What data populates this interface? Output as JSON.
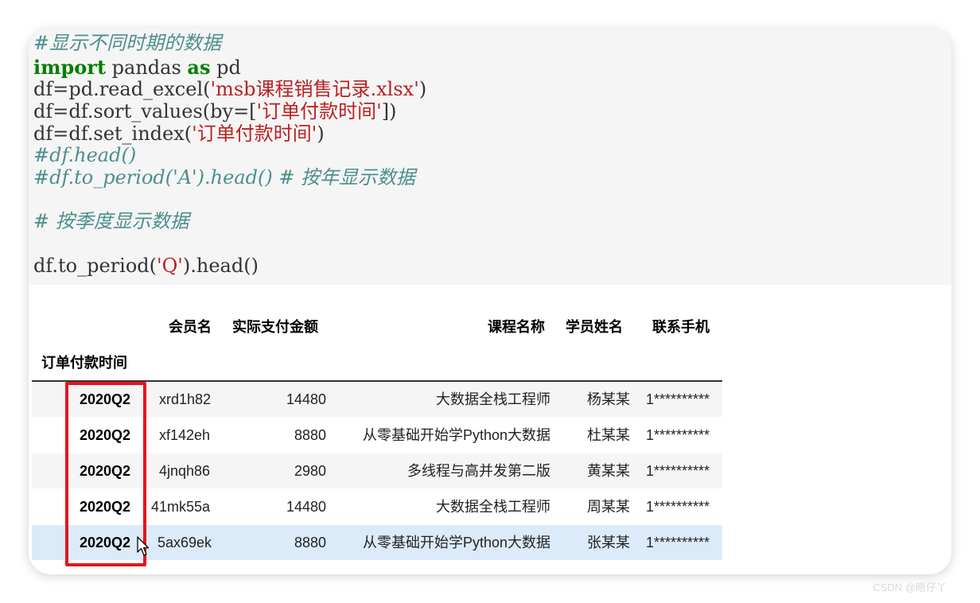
{
  "code_cell": {
    "lines": [
      {
        "segments": [
          {
            "cls": "cm",
            "text": "#显示不同时期的数据"
          }
        ]
      },
      {
        "segments": [
          {
            "cls": "kw",
            "text": "import"
          },
          {
            "cls": "",
            "text": " pandas "
          },
          {
            "cls": "kw",
            "text": "as"
          },
          {
            "cls": "",
            "text": " pd"
          }
        ]
      },
      {
        "segments": [
          {
            "cls": "",
            "text": "df=pd.read_excel("
          },
          {
            "cls": "st",
            "text": "'msb课程销售记录.xlsx'"
          },
          {
            "cls": "",
            "text": ")"
          }
        ]
      },
      {
        "segments": [
          {
            "cls": "",
            "text": "df=df.sort_values(by=["
          },
          {
            "cls": "st",
            "text": "'订单付款时间'"
          },
          {
            "cls": "",
            "text": "])"
          }
        ]
      },
      {
        "segments": [
          {
            "cls": "",
            "text": "df=df.set_index("
          },
          {
            "cls": "st",
            "text": "'订单付款时间'"
          },
          {
            "cls": "",
            "text": ")"
          }
        ]
      },
      {
        "segments": [
          {
            "cls": "cm",
            "text": "#df.head()"
          }
        ]
      },
      {
        "segments": [
          {
            "cls": "cm",
            "text": "#df.to_period('A').head() # 按年显示数据"
          }
        ]
      },
      {
        "segments": [
          {
            "cls": "cm",
            "text": "# 按季度显示数据"
          }
        ]
      },
      {
        "segments": [
          {
            "cls": "",
            "text": "df.to_period("
          },
          {
            "cls": "st",
            "text": "'Q'"
          },
          {
            "cls": "",
            "text": ").head()"
          }
        ]
      }
    ]
  },
  "table": {
    "columns": [
      "会员名",
      "实际支付金额",
      "课程名称",
      "学员姓名",
      "联系手机"
    ],
    "index_name": "订单付款时间",
    "rows": [
      {
        "index": "2020Q2",
        "cells": [
          "xrd1h82",
          "14480",
          "大数据全栈工程师",
          "杨某某",
          "1**********"
        ]
      },
      {
        "index": "2020Q2",
        "cells": [
          "xf142eh",
          "8880",
          "从零基础开始学Python大数据",
          "杜某某",
          "1**********"
        ]
      },
      {
        "index": "2020Q2",
        "cells": [
          "4jnqh86",
          "2980",
          "多线程与高并发第二版",
          "黄某某",
          "1**********"
        ]
      },
      {
        "index": "2020Q2",
        "cells": [
          "41mk55a",
          "14480",
          "大数据全栈工程师",
          "周某某",
          "1**********"
        ]
      },
      {
        "index": "2020Q2",
        "cells": [
          "5ax69ek",
          "8880",
          "从零基础开始学Python大数据",
          "张某某",
          "1**********"
        ]
      }
    ]
  },
  "watermark": "CSDN @晤仔丫",
  "colors": {
    "highlight": "#e8141c",
    "hover_row": "#dcebfa",
    "comment": "#4e8e8e",
    "keyword": "#008000",
    "string": "#ba2121"
  }
}
